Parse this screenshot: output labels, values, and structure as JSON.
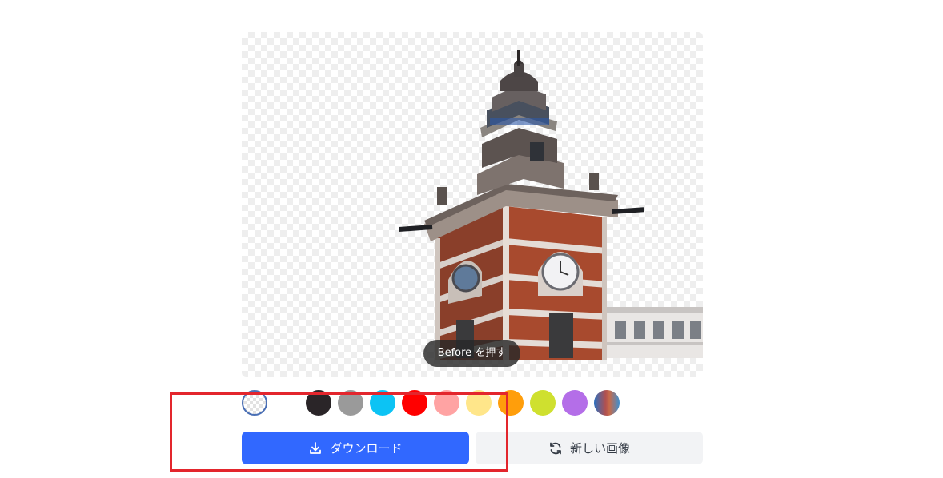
{
  "preview": {
    "before_button_label": "Before を押す"
  },
  "background_colors": [
    {
      "name": "transparent",
      "color": "transparent",
      "selected": true
    },
    {
      "name": "white",
      "color": "#ffffff"
    },
    {
      "name": "black",
      "color": "#2a2528"
    },
    {
      "name": "gray",
      "color": "#9a9a9a"
    },
    {
      "name": "sky-blue",
      "color": "#0cc3f4"
    },
    {
      "name": "red",
      "color": "#ff0000"
    },
    {
      "name": "pink",
      "color": "#ffa3a3"
    },
    {
      "name": "light-yellow",
      "color": "#ffe68a"
    },
    {
      "name": "orange",
      "color": "#ff9e0b"
    },
    {
      "name": "lime",
      "color": "#cfe02f"
    },
    {
      "name": "purple",
      "color": "#b46ee8"
    },
    {
      "name": "gradient",
      "color": "gradient"
    }
  ],
  "actions": {
    "download_label": "ダウンロード",
    "new_image_label": "新しい画像"
  },
  "icons": {
    "download": "download-icon",
    "refresh": "refresh-icon"
  },
  "colors": {
    "primary": "#3168ff",
    "secondary_bg": "#f2f3f5",
    "highlight": "#e3262d"
  }
}
